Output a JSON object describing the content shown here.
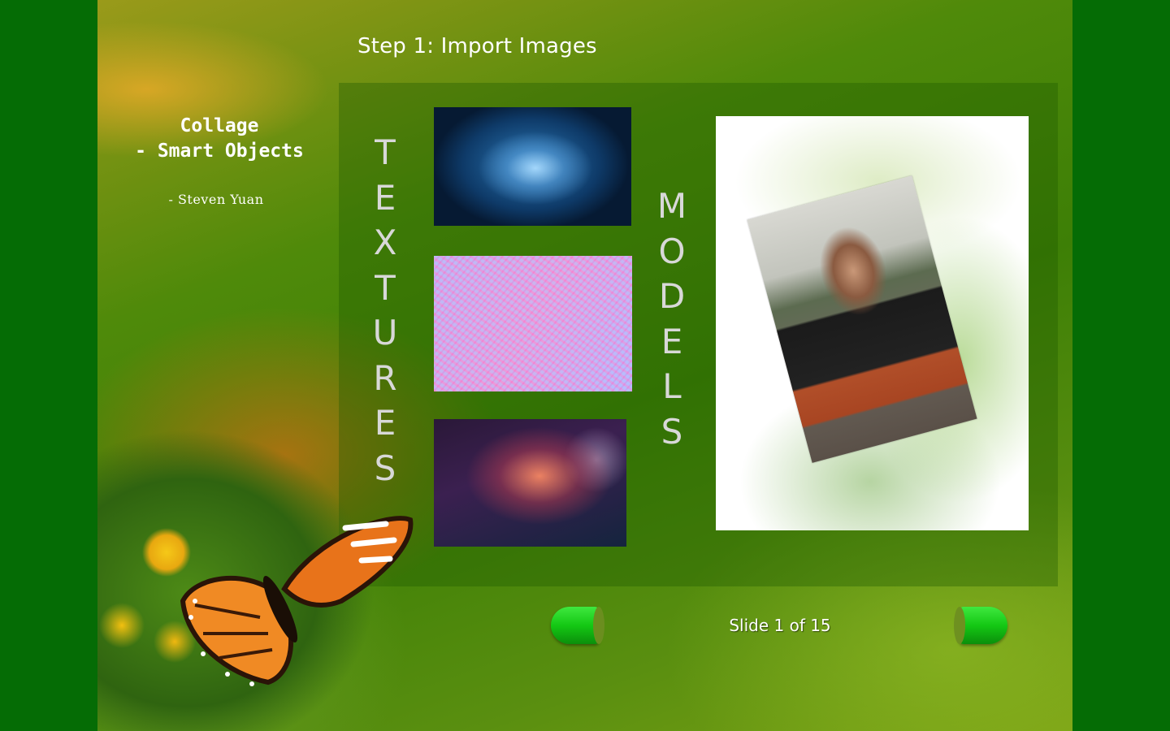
{
  "slide": {
    "step_title": "Step 1: Import Images",
    "deck_title": "Collage\n- Smart Objects",
    "author": "- Steven Yuan",
    "textures_label": [
      "T",
      "E",
      "X",
      "T",
      "U",
      "R",
      "E",
      "S"
    ],
    "models_label": [
      "M",
      "O",
      "D",
      "E",
      "L",
      "S"
    ],
    "counter": "Slide 1 of 15"
  },
  "colors": {
    "outer_background": "#056c05",
    "nav_button": "#14c814",
    "vertical_label": "#d8d8d8"
  },
  "icons": {
    "prev": "prev-arrow-icon",
    "next": "next-arrow-icon"
  }
}
